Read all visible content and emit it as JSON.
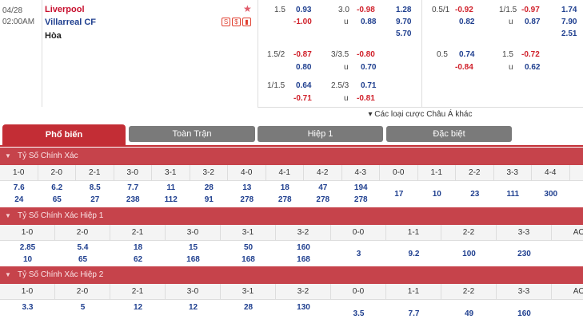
{
  "match": {
    "date": "04/28",
    "time": "02:00AM",
    "home": "Liverpool",
    "away": "Villarreal CF",
    "draw": "Hòa",
    "icons": [
      "S",
      "$",
      "bar-chart"
    ]
  },
  "odds": {
    "r1": [
      "1.5",
      "0.93",
      "-1.00",
      "3.0",
      "-0.98",
      "u",
      "0.88",
      "1.28",
      "9.70",
      "5.70",
      "0.5/1",
      "-0.92",
      "0.82",
      "1/1.5",
      "-0.97",
      "u",
      "0.87",
      "1.74",
      "7.90",
      "2.51"
    ],
    "r2": [
      "1.5/2",
      "-0.87",
      "0.80",
      "3/3.5",
      "-0.80",
      "u",
      "0.70",
      "0.5",
      "0.74",
      "-0.84",
      "1.5",
      "-0.72",
      "u",
      "0.62"
    ],
    "r3": [
      "1/1.5",
      "0.64",
      "-0.71",
      "2.5/3",
      "0.71",
      "u",
      "-0.81"
    ]
  },
  "more_odds_label": "▾ Các loại cược Châu Á khác",
  "tabs": [
    "Phổ biến",
    "Toàn Trận",
    "Hiệp 1",
    "Đặc biệt"
  ],
  "sections": [
    {
      "title": "Tỷ Số Chính Xác",
      "cols": [
        "1-0",
        "2-0",
        "2-1",
        "3-0",
        "3-1",
        "3-2",
        "4-0",
        "4-1",
        "4-2",
        "4-3",
        "0-0",
        "1-1",
        "2-2",
        "3-3",
        "4-4"
      ],
      "row1": [
        "7.6",
        "6.2",
        "8.5",
        "7.7",
        "11",
        "28",
        "13",
        "18",
        "47",
        "194",
        "17",
        "10",
        "23",
        "111",
        "300"
      ],
      "row2": [
        "24",
        "65",
        "27",
        "238",
        "112",
        "91",
        "278",
        "278",
        "278",
        "278",
        "",
        "",
        "",
        "",
        ""
      ]
    },
    {
      "title": "Tỷ Số Chính Xác Hiệp 1",
      "cols": [
        "1-0",
        "2-0",
        "2-1",
        "3-0",
        "3-1",
        "3-2",
        "0-0",
        "1-1",
        "2-2",
        "3-3",
        "AO"
      ],
      "row1": [
        "2.85",
        "5.4",
        "18",
        "15",
        "50",
        "160",
        "3",
        "9.2",
        "100",
        "230",
        ""
      ],
      "row2": [
        "10",
        "65",
        "62",
        "168",
        "168",
        "168",
        "",
        "",
        "",
        "",
        ""
      ]
    },
    {
      "title": "Tỷ Số Chính Xác Hiệp 2",
      "row1": [
        "3.3",
        "5",
        "12",
        "12",
        "28",
        "130",
        "3.5",
        "7.7",
        "49",
        "160",
        ""
      ]
    }
  ]
}
